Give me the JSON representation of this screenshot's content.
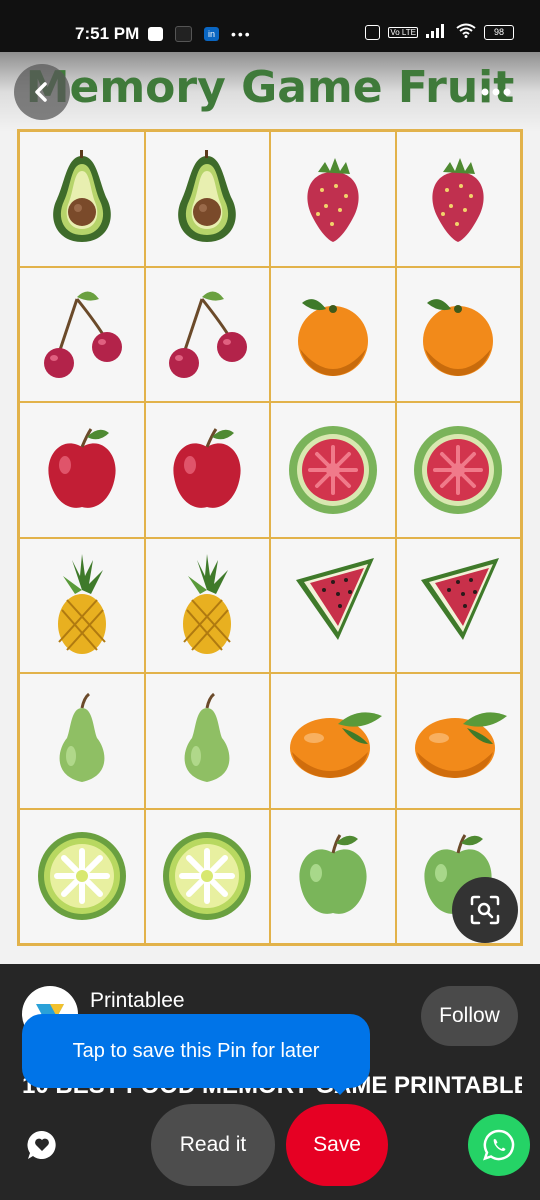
{
  "status": {
    "time": "7:51 PM",
    "battery": "98",
    "network": "Vo LTE"
  },
  "pin": {
    "title": "Memory Game Fruit",
    "grid_rows": [
      [
        "avocado",
        "avocado",
        "strawberry",
        "strawberry"
      ],
      [
        "cherry",
        "cherry",
        "orange",
        "orange"
      ],
      [
        "apple",
        "apple",
        "guava",
        "guava"
      ],
      [
        "pineapple",
        "pineapple",
        "watermelon",
        "watermelon"
      ],
      [
        "pear",
        "pear",
        "tangerine",
        "tangerine"
      ],
      [
        "lime",
        "lime",
        "green-apple",
        "green-apple"
      ]
    ]
  },
  "creator": {
    "name": "Printablee",
    "follow_label": "Follow"
  },
  "description": "10 BEST FOOD MEMORY GAME PRINTABLE",
  "tooltip": "Tap to save this Pin for later",
  "actions": {
    "read_label": "Read it",
    "save_label": "Save"
  },
  "colors": {
    "save": "#e60023",
    "tooltip": "#0074e8",
    "whatsapp": "#25d366",
    "title_green": "#3f7a3a"
  }
}
